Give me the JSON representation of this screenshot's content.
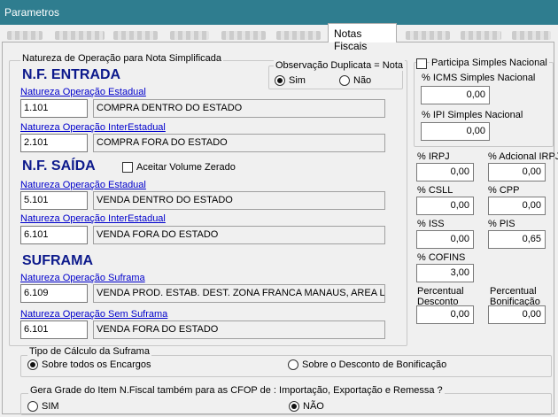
{
  "window": {
    "title": "Parametros"
  },
  "tabs": {
    "active": "Notas Fiscais"
  },
  "natureza": {
    "group_label": "Natureza de Operação para Nota Simplificada",
    "entrada": {
      "heading": "N.F. ENTRADA",
      "estadual_link": "Natureza Operação Estadual",
      "estadual_code": "1.101",
      "estadual_desc": "COMPRA DENTRO DO ESTADO",
      "interestadual_link": "Natureza Operação InterEstadual",
      "interestadual_code": "2.101",
      "interestadual_desc": "COMPRA FORA DO ESTADO"
    },
    "obs_dup": {
      "label": "Observação Duplicata = Nota",
      "sim": "Sim",
      "nao": "Não"
    },
    "saida": {
      "heading": "N.F. SAÍDA",
      "aceitar_label": "Aceitar Volume Zerado",
      "estadual_link": "Natureza Operação Estadual",
      "estadual_code": "5.101",
      "estadual_desc": "VENDA DENTRO DO ESTADO",
      "interestadual_link": "Natureza Operação InterEstadual",
      "interestadual_code": "6.101",
      "interestadual_desc": "VENDA FORA DO ESTADO"
    },
    "suframa": {
      "heading": "SUFRAMA",
      "com_link": "Natureza Operação Suframa",
      "com_code": "6.109",
      "com_desc": "VENDA PROD. ESTAB. DEST. ZONA FRANCA MANAUS, AREA L",
      "sem_link": "Natureza Operação Sem Suframa",
      "sem_code": "6.101",
      "sem_desc": "VENDA FORA DO ESTADO"
    }
  },
  "simples": {
    "participa_label": "Participa Simples Nacional",
    "icms_label": "% ICMS Simples Nacional",
    "icms_value": "0,00",
    "ipi_label": "% IPI Simples Nacional",
    "ipi_value": "0,00"
  },
  "taxes": {
    "irpj_label": "% IRPJ",
    "irpj_value": "0,00",
    "adicional_label": "% Adcional IRPJ",
    "adicional_value": "0,00",
    "csll_label": "% CSLL",
    "csll_value": "0,00",
    "cpp_label": "% CPP",
    "cpp_value": "0,00",
    "iss_label": "% ISS",
    "iss_value": "0,00",
    "pis_label": "% PIS",
    "pis_value": "0,65",
    "cofins_label": "% COFINS",
    "cofins_value": "3,00",
    "desconto_label_1": "Percentual",
    "desconto_label_2": "Desconto",
    "desconto_value": "0,00",
    "bonificacao_label_1": "Percentual",
    "bonificacao_label_2": "Bonificação",
    "bonificacao_value": "0,00"
  },
  "calculo_suframa": {
    "label": "Tipo de Cálculo da Suframa",
    "opt1": "Sobre todos os Encargos",
    "opt2": "Sobre o Desconto de Bonificação"
  },
  "gera_grade": {
    "label": "Gera Grade do Item N.Fiscal também para as CFOP de : Importação, Exportação e Remessa ?",
    "sim": "SIM",
    "nao": "NÃO"
  }
}
